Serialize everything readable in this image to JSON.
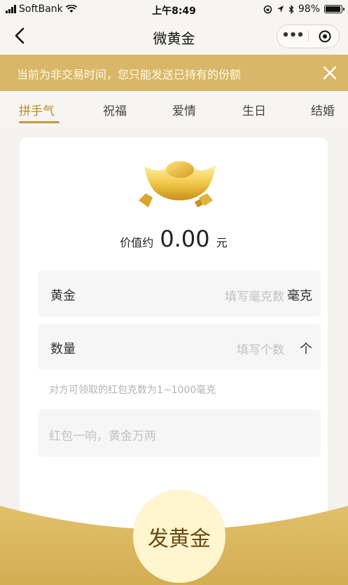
{
  "status": {
    "carrier": "SoftBank",
    "time": "上午8:49",
    "battery": "98%",
    "battery_level": 0.98
  },
  "nav": {
    "title": "微黄金"
  },
  "notice": {
    "text": "当前为非交易时间，您只能发送已持有的份额"
  },
  "tabs": [
    {
      "label": "拼手气",
      "active": true
    },
    {
      "label": "祝福"
    },
    {
      "label": "爱情"
    },
    {
      "label": "生日"
    },
    {
      "label": "结婚"
    }
  ],
  "value": {
    "prefix": "价值约",
    "amount": "0.00",
    "unit": "元"
  },
  "gold_field": {
    "label": "黄金",
    "placeholder": "填写毫克数",
    "unit": "毫克"
  },
  "qty_field": {
    "label": "数量",
    "placeholder": "填写个数",
    "unit": "个"
  },
  "hint": "对方可领取的红包克数为1~1000毫克",
  "message": {
    "placeholder": "红包一响，黄金万两"
  },
  "send_button": "发黄金",
  "colors": {
    "accent": "#d8b868",
    "tab_active": "#b98a2c",
    "button_bg": "#fff5cf"
  }
}
